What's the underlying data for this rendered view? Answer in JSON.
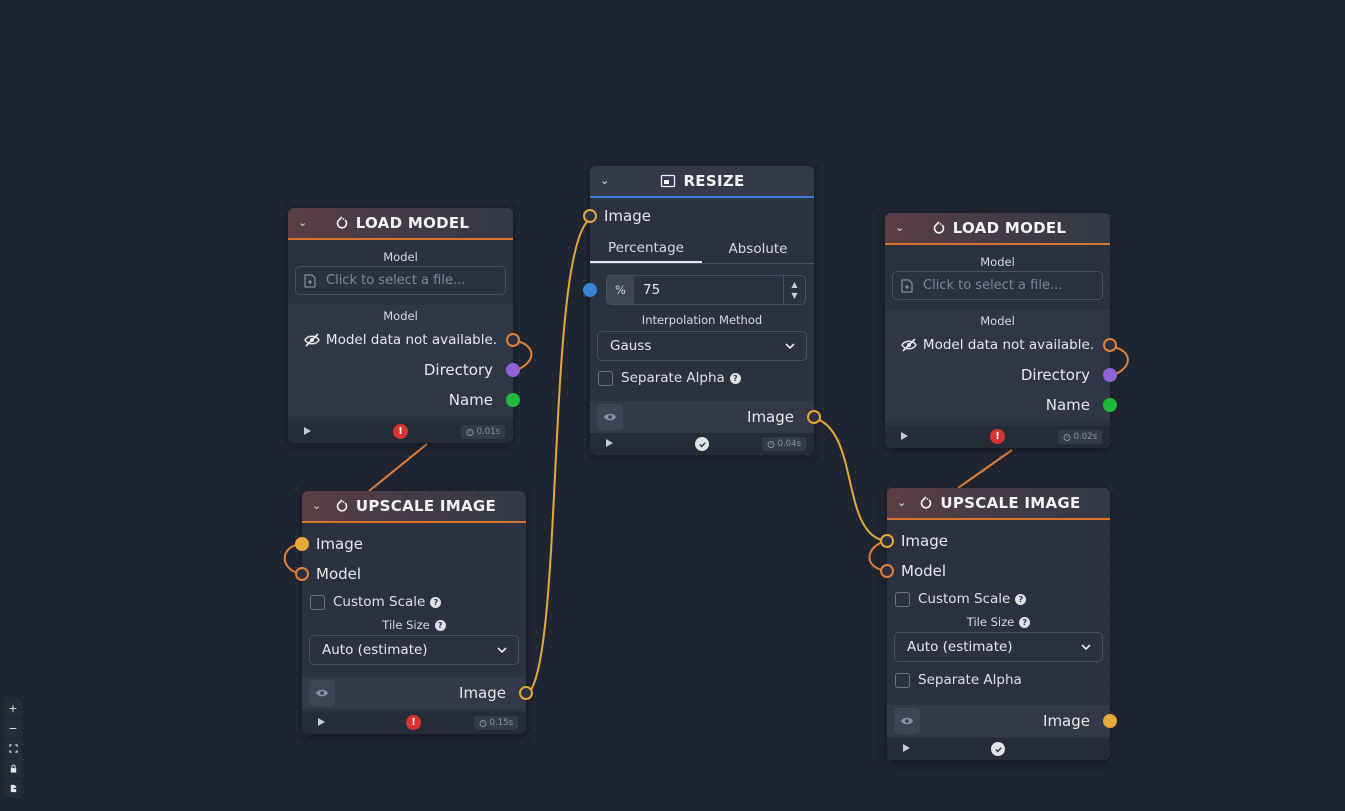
{
  "colors": {
    "pytorch_accent": "#d8742e",
    "image_accent": "#3b7fd0",
    "edge_orange": "#e0803a",
    "edge_yellow": "#e3a93a",
    "directory_handle": "#8c63d8",
    "name_handle": "#1fba3c",
    "number_handle": "#3a85d8",
    "error": "#d9342f"
  },
  "load_model_1": {
    "title": "LOAD MODEL",
    "input_label": "Model",
    "file_placeholder": "Click to select a file...",
    "output_label": "Model",
    "unavailable": "Model data not available.",
    "directory": "Directory",
    "name": "Name",
    "timer": "0.01s",
    "status": "error"
  },
  "upscale_1": {
    "title": "UPSCALE IMAGE",
    "image_input": "Image",
    "model_input": "Model",
    "custom_scale": "Custom Scale",
    "tile_size_label": "Tile Size",
    "tile_size_value": "Auto (estimate)",
    "output": "Image",
    "timer": "0.15s",
    "status": "error"
  },
  "resize": {
    "title": "RESIZE",
    "image_input": "Image",
    "tabs": [
      "Percentage",
      "Absolute"
    ],
    "active_tab": "Percentage",
    "percent_prefix": "%",
    "percent_value": "75",
    "interp_label": "Interpolation Method",
    "interp_value": "Gauss",
    "separate_alpha": "Separate Alpha",
    "output": "Image",
    "timer": "0.04s",
    "status": "ok"
  },
  "load_model_2": {
    "title": "LOAD MODEL",
    "input_label": "Model",
    "file_placeholder": "Click to select a file...",
    "output_label": "Model",
    "unavailable": "Model data not available.",
    "directory": "Directory",
    "name": "Name",
    "timer": "0.02s",
    "status": "error"
  },
  "upscale_2": {
    "title": "UPSCALE IMAGE",
    "image_input": "Image",
    "model_input": "Model",
    "custom_scale": "Custom Scale",
    "tile_size_label": "Tile Size",
    "tile_size_value": "Auto (estimate)",
    "separate_alpha": "Separate Alpha",
    "output": "Image",
    "status": "ok"
  },
  "icons": {
    "pytorch": "pytorch-icon",
    "resize": "resize-icon",
    "file": "file-icon",
    "eye_off": "eye-off-icon",
    "eye": "eye-icon",
    "play": "play-icon",
    "error": "error-icon",
    "check": "check-icon",
    "timer": "timer-icon",
    "chevron": "chevron-down-icon",
    "help": "help-icon"
  },
  "status_glyphs": {
    "error": "!",
    "help": "?"
  },
  "zoom_controls": {
    "zoom_in": "+",
    "zoom_out": "−"
  }
}
